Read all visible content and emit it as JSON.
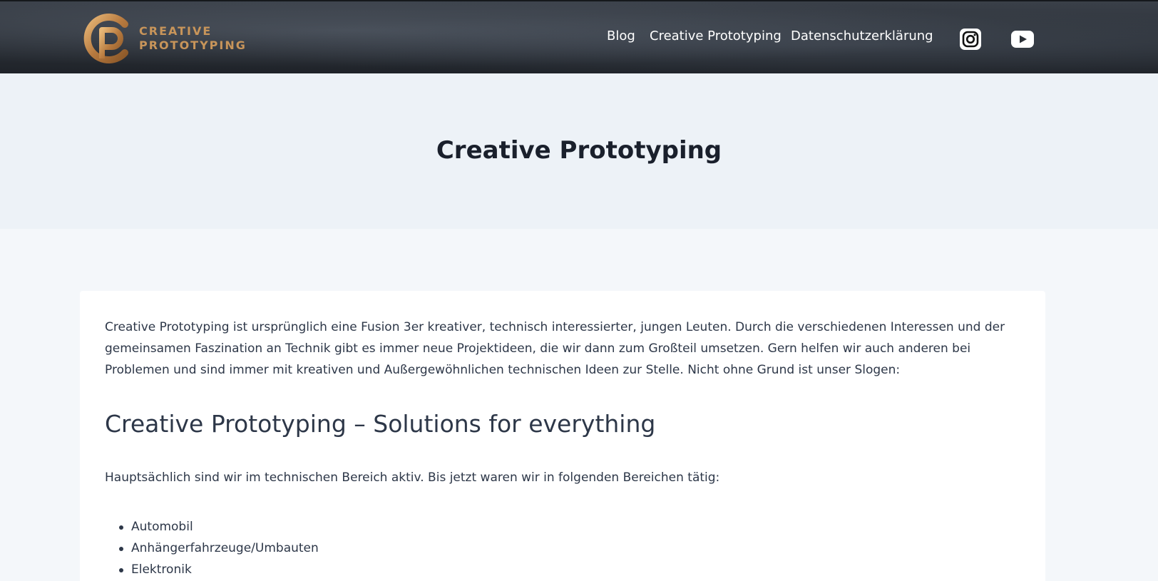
{
  "header": {
    "logo": {
      "line1": "CREATIVE",
      "line2": "PROTOTYPING",
      "mark": "CP"
    },
    "nav": [
      {
        "label": "Blog"
      },
      {
        "label": "Creative Prototyping"
      },
      {
        "label": "Datenschutzerklärung"
      }
    ],
    "social": [
      {
        "icon": "instagram-icon"
      },
      {
        "icon": "youtube-icon"
      }
    ]
  },
  "hero": {
    "title": "Creative Prototyping"
  },
  "content": {
    "intro": "Creative Prototyping ist ursprünglich eine Fusion 3er kreativer, technisch interessierter, jungen Leuten. Durch die verschiedenen Interessen und der gemeinsamen Faszination an Technik gibt es immer neue Projektideen, die wir dann zum Großteil umsetzen. Gern helfen wir auch anderen bei Problemen und sind immer mit kreativen und Außergewöhnlichen technischen Ideen zur Stelle. Nicht ohne Grund ist unser Slogen:",
    "subheading": "Creative Prototyping – Solutions for everything",
    "lead": "Hauptsächlich sind wir im technischen Bereich aktiv. Bis jetzt waren wir in folgenden Bereichen tätig:",
    "areas": [
      "Automobil",
      "Anhängerfahrzeuge/Umbauten",
      "Elektronik"
    ]
  },
  "colors": {
    "header_bg": "#2a2f36",
    "logo_gold": "#c8955a",
    "hero_bg": "#edf2f7",
    "page_bg": "#f4f7fa",
    "text": "#2d3748"
  }
}
